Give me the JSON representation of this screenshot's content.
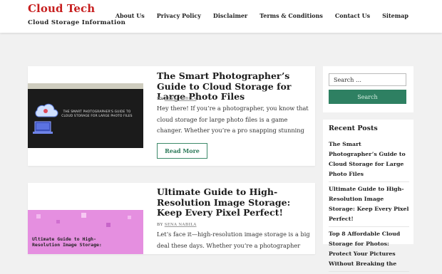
{
  "site": {
    "title": "Cloud Tech",
    "tagline": "Cloud Storage Information"
  },
  "nav": [
    "About Us",
    "Privacy Policy",
    "Disclaimer",
    "Terms & Conditions",
    "Contact Us",
    "Sitemap"
  ],
  "posts": [
    {
      "title": "The Smart Photographer’s Guide to Cloud Storage for Large Photo Files",
      "by": "BY",
      "author": "SENA NABILA",
      "excerpt": "Hey there! If you’re a photographer, you know that cloud storage for large photo files is a game changer.  Whether you’re a pro snapping stunning",
      "thumb_text": "THE SMART PHOTOGRAPHER'S GUIDE TO CLOUD STORAGE FOR LARGE PHOTO FILES",
      "read_more": "Read More"
    },
    {
      "title": "Ultimate Guide to High-Resolution Image Storage: Keep Every Pixel Perfect!",
      "by": "BY",
      "author": "SENA NABILA",
      "excerpt": "Let’s face it—high-resolution image storage is a big deal these days. Whether you’re a photographer",
      "thumb_text": "Ultimate Guide to High-Resolution Image Storage:"
    }
  ],
  "search": {
    "placeholder": "Search …",
    "button": "Search"
  },
  "recent": {
    "title": "Recent Posts",
    "items": [
      "The Smart Photographer’s Guide to Cloud Storage for Large Photo Files",
      "Ultimate Guide to High-Resolution Image Storage: Keep Every Pixel Perfect!",
      "Top 8 Affordable Cloud Storage for Photos: Protect Your Pictures Without Breaking the"
    ]
  },
  "colors": {
    "brand": "#c71f1f",
    "accent": "#2e8062"
  }
}
